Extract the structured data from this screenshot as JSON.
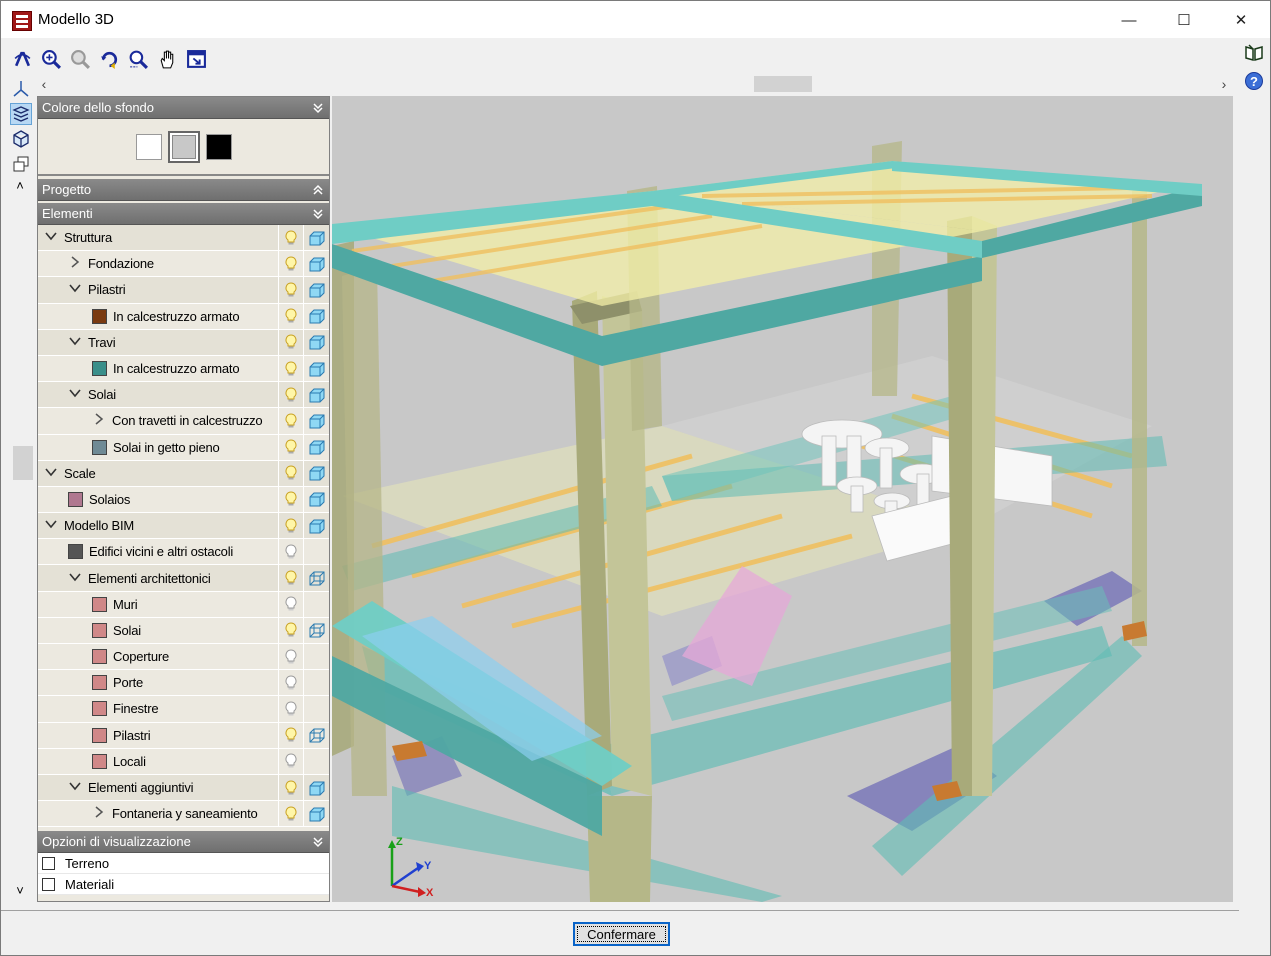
{
  "window": {
    "title": "Modello 3D",
    "minimize": "—",
    "maximize": "☐",
    "close": "✕"
  },
  "toolbar": {
    "icons": [
      "rotate-view-icon",
      "zoom-extents-icon",
      "zoom-window-icon",
      "refresh-view-icon",
      "zoom-icon",
      "pan-hand-icon",
      "export-view-icon"
    ]
  },
  "right_icons": [
    "help-book-icon",
    "help-question-icon"
  ],
  "panel": {
    "background_section": {
      "title": "Colore dello sfondo",
      "colors": [
        "#ffffff",
        "#c8c8c8",
        "#000000"
      ],
      "selected": 1
    },
    "progetto": {
      "title": "Progetto"
    },
    "elementi": {
      "title": "Elementi",
      "rows": [
        {
          "label": "Struttura",
          "level": 0,
          "expand": "open",
          "color": "",
          "bulb": "on",
          "cube": "solid"
        },
        {
          "label": "Fondazione",
          "level": 1,
          "expand": "closed",
          "color": "",
          "bulb": "on",
          "cube": "solid"
        },
        {
          "label": "Pilastri",
          "level": 1,
          "expand": "open",
          "color": "",
          "bulb": "on",
          "cube": "solid"
        },
        {
          "label": "In calcestruzzo armato",
          "level": 2,
          "expand": "",
          "color": "#7a3a10",
          "bulb": "on",
          "cube": "solid"
        },
        {
          "label": "Travi",
          "level": 1,
          "expand": "open",
          "color": "",
          "bulb": "on",
          "cube": "solid"
        },
        {
          "label": "In calcestruzzo armato",
          "level": 2,
          "expand": "",
          "color": "#3a8f8a",
          "bulb": "on",
          "cube": "solid"
        },
        {
          "label": "Solai",
          "level": 1,
          "expand": "open",
          "color": "",
          "bulb": "on",
          "cube": "solid"
        },
        {
          "label": "Con travetti in calcestruzzo",
          "level": 2,
          "expand": "closed",
          "color": "",
          "bulb": "on",
          "cube": "solid"
        },
        {
          "label": "Solai in getto pieno",
          "level": 2,
          "expand": "",
          "color": "#6f8a95",
          "bulb": "on",
          "cube": "solid"
        },
        {
          "label": "Scale",
          "level": 0,
          "expand": "open",
          "color": "",
          "bulb": "on",
          "cube": "solid"
        },
        {
          "label": "Solaios",
          "level": 1,
          "expand": "",
          "color": "#b07890",
          "bulb": "on",
          "cube": "solid"
        },
        {
          "label": "Modello BIM",
          "level": 0,
          "expand": "open",
          "color": "",
          "bulb": "on",
          "cube": "solid"
        },
        {
          "label": "Edifici vicini e altri ostacoli",
          "level": 1,
          "expand": "",
          "color": "#555555",
          "bulb": "off",
          "cube": ""
        },
        {
          "label": "Elementi architettonici",
          "level": 1,
          "expand": "open",
          "color": "",
          "bulb": "on",
          "cube": "wire"
        },
        {
          "label": "Muri",
          "level": 2,
          "expand": "",
          "color": "#d08888",
          "bulb": "off",
          "cube": ""
        },
        {
          "label": "Solai",
          "level": 2,
          "expand": "",
          "color": "#d08888",
          "bulb": "on",
          "cube": "wire"
        },
        {
          "label": "Coperture",
          "level": 2,
          "expand": "",
          "color": "#d08888",
          "bulb": "off",
          "cube": ""
        },
        {
          "label": "Porte",
          "level": 2,
          "expand": "",
          "color": "#d08888",
          "bulb": "off",
          "cube": ""
        },
        {
          "label": "Finestre",
          "level": 2,
          "expand": "",
          "color": "#d08888",
          "bulb": "off",
          "cube": ""
        },
        {
          "label": "Pilastri",
          "level": 2,
          "expand": "",
          "color": "#d08888",
          "bulb": "on",
          "cube": "wire"
        },
        {
          "label": "Locali",
          "level": 2,
          "expand": "",
          "color": "#d08888",
          "bulb": "off",
          "cube": ""
        },
        {
          "label": "Elementi aggiuntivi",
          "level": 1,
          "expand": "open",
          "color": "",
          "bulb": "on",
          "cube": "solid"
        },
        {
          "label": "Fontaneria y saneamiento",
          "level": 2,
          "expand": "closed",
          "color": "",
          "bulb": "on",
          "cube": "solid"
        }
      ]
    },
    "opzioni": {
      "title": "Opzioni di visualizzazione",
      "items": [
        {
          "label": "Terreno",
          "checked": false
        },
        {
          "label": "Materiali",
          "checked": false
        }
      ]
    }
  },
  "viewport": {
    "axes": {
      "z": "Z",
      "y": "Y",
      "x": "X"
    }
  },
  "footer": {
    "confirm_label": "Confermare"
  }
}
